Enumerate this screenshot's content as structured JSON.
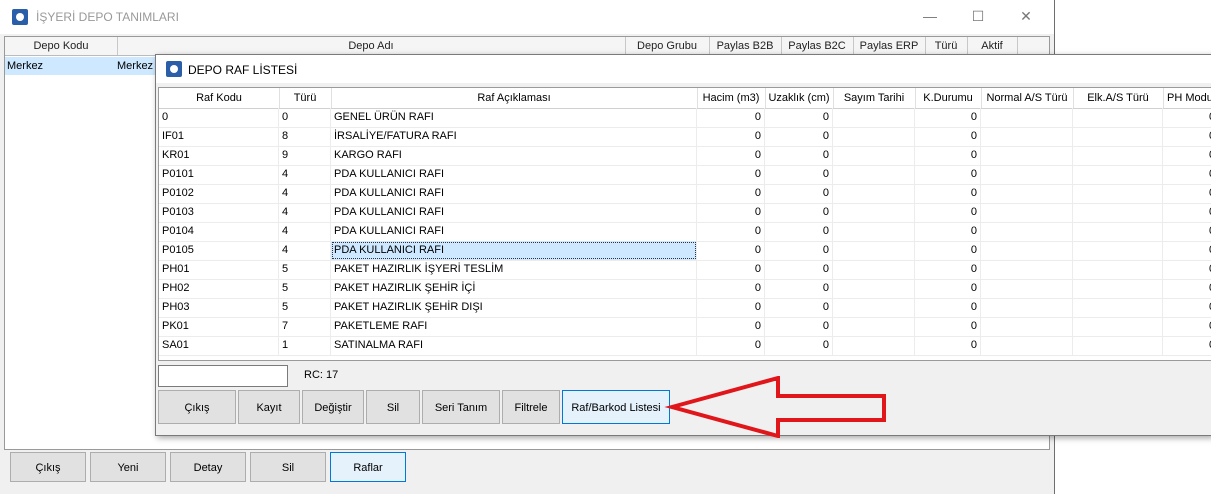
{
  "outer": {
    "title": "İŞYERİ DEPO TANIMLARI",
    "columns": [
      "Depo Kodu",
      "Depo Adı",
      "Depo Grubu",
      "Paylas B2B",
      "Paylas B2C",
      "Paylas ERP",
      "Türü",
      "Aktif"
    ],
    "row": {
      "kod": "Merkez",
      "ad": "Merkez"
    },
    "buttons": [
      "Çıkış",
      "Yeni",
      "Detay",
      "Sil",
      "Raflar"
    ],
    "window_controls": {
      "minimize": "—",
      "maximize": "☐",
      "close": "✕"
    }
  },
  "dialog": {
    "title": "DEPO RAF LİSTESİ",
    "columns": [
      "Raf Kodu",
      "Türü",
      "Raf Açıklaması",
      "Hacim (m3)",
      "Uzaklık (cm)",
      "Sayım Tarihi",
      "K.Durumu",
      "Normal A/S Türü",
      "Elk.A/S Türü",
      "PH Modu"
    ],
    "rows": [
      {
        "kod": "0",
        "tur": "0",
        "aciklama": "GENEL ÜRÜN RAFI",
        "hacim": "0",
        "uzaklik": "0",
        "kdurum": "0",
        "ph": "0"
      },
      {
        "kod": "IF01",
        "tur": "8",
        "aciklama": "İRSALİYE/FATURA RAFI",
        "hacim": "0",
        "uzaklik": "0",
        "kdurum": "0",
        "ph": "0"
      },
      {
        "kod": "KR01",
        "tur": "9",
        "aciklama": "KARGO RAFI",
        "hacim": "0",
        "uzaklik": "0",
        "kdurum": "0",
        "ph": "0"
      },
      {
        "kod": "P0101",
        "tur": "4",
        "aciklama": "PDA KULLANICI RAFI",
        "hacim": "0",
        "uzaklik": "0",
        "kdurum": "0",
        "ph": "0"
      },
      {
        "kod": "P0102",
        "tur": "4",
        "aciklama": "PDA KULLANICI RAFI",
        "hacim": "0",
        "uzaklik": "0",
        "kdurum": "0",
        "ph": "0"
      },
      {
        "kod": "P0103",
        "tur": "4",
        "aciklama": "PDA KULLANICI RAFI",
        "hacim": "0",
        "uzaklik": "0",
        "kdurum": "0",
        "ph": "0"
      },
      {
        "kod": "P0104",
        "tur": "4",
        "aciklama": "PDA KULLANICI RAFI",
        "hacim": "0",
        "uzaklik": "0",
        "kdurum": "0",
        "ph": "0"
      },
      {
        "kod": "P0105",
        "tur": "4",
        "aciklama": "PDA KULLANICI RAFI",
        "hacim": "0",
        "uzaklik": "0",
        "kdurum": "0",
        "ph": "0",
        "focused": true
      },
      {
        "kod": "PH01",
        "tur": "5",
        "aciklama": "PAKET HAZIRLIK İŞYERİ TESLİM",
        "hacim": "0",
        "uzaklik": "0",
        "kdurum": "0",
        "ph": "0"
      },
      {
        "kod": "PH02",
        "tur": "5",
        "aciklama": "PAKET HAZIRLIK ŞEHİR İÇİ",
        "hacim": "0",
        "uzaklik": "0",
        "kdurum": "0",
        "ph": "0"
      },
      {
        "kod": "PH03",
        "tur": "5",
        "aciklama": "PAKET HAZIRLIK ŞEHİR DIŞI",
        "hacim": "0",
        "uzaklik": "0",
        "kdurum": "0",
        "ph": "0"
      },
      {
        "kod": "PK01",
        "tur": "7",
        "aciklama": "PAKETLEME RAFI",
        "hacim": "0",
        "uzaklik": "0",
        "kdurum": "0",
        "ph": "0"
      },
      {
        "kod": "SA01",
        "tur": "1",
        "aciklama": "SATINALMA RAFI",
        "hacim": "0",
        "uzaklik": "0",
        "kdurum": "0",
        "ph": "0"
      }
    ],
    "status_text": "RC: 17",
    "status_input": "",
    "buttons": [
      "Çıkış",
      "Kayıt",
      "Değiştir",
      "Sil",
      "Seri Tanım",
      "Filtrele",
      "Raf/Barkod Listesi"
    ]
  },
  "annotation": {
    "arrow_color": "#e0161b"
  }
}
